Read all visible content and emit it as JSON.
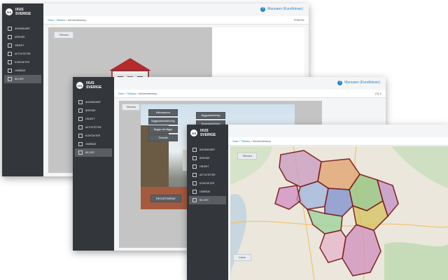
{
  "brand": {
    "logo_text": "iXS",
    "name": "IXUS SVERIGE"
  },
  "nav": [
    {
      "label": "ANVÄNDARE",
      "icon": "user-icon"
    },
    {
      "label": "ÄRENDE",
      "icon": "document-icon"
    },
    {
      "label": "OBJEKT",
      "icon": "building-icon"
    },
    {
      "label": "AKTIVITETER",
      "icon": "activity-icon"
    },
    {
      "label": "KONTAKTER",
      "icon": "contacts-icon"
    },
    {
      "label": "OMRÅDE",
      "icon": "area-icon"
    },
    {
      "label": "BILDER",
      "icon": "image-icon"
    }
  ],
  "help_link": "Manuaen (Kundhävan)",
  "breadcrumb": {
    "home": "Start",
    "sep": "/",
    "section": "Tillbaka",
    "page": "Informationsvy"
  },
  "top_right_code": "FR5/001",
  "back_button": "Tillbaka",
  "win2": {
    "menu_left": [
      "Hälsosamma",
      "Byggnadsbeskrivning",
      "Bygga och lägga",
      "Översikt"
    ],
    "menu_right": [
      "Byggnadsdelning 1981/09",
      "Byggnadsdelning 1981/89"
    ],
    "overlay_button": "REGISTRERAT",
    "top_right_code": "[X] X"
  },
  "win3": {
    "map_label": "Karta",
    "map_back": "Tillbaka",
    "map_label_bottom": "Karta"
  },
  "colors": {
    "sidebar": "#33373b",
    "accent": "#2a84c9"
  }
}
